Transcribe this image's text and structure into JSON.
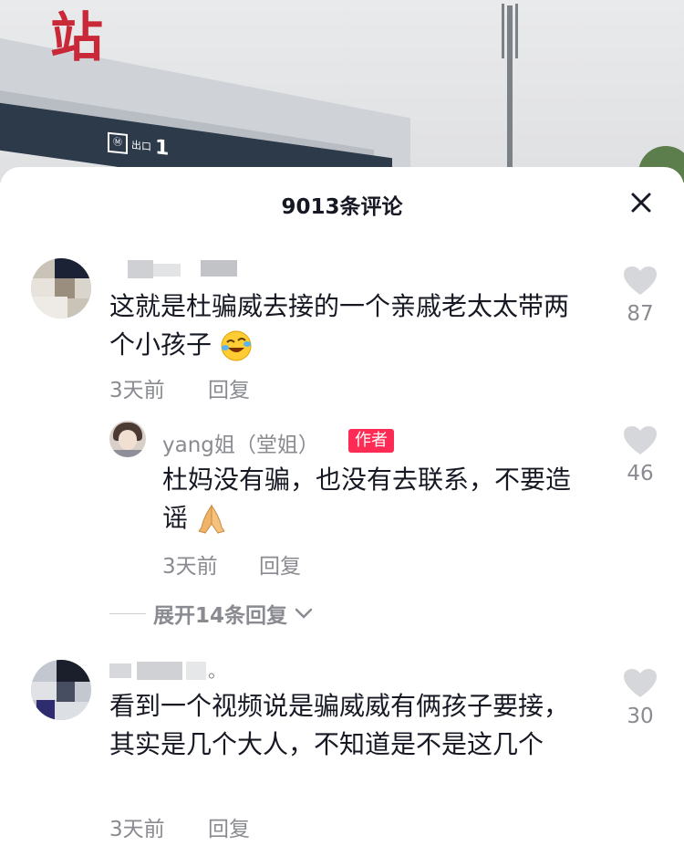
{
  "background": {
    "sign_char": "站",
    "exit_label": "出口",
    "exit_number": "1"
  },
  "header": {
    "title": "9013条评论"
  },
  "comments": [
    {
      "text": "这就是杜骗威去接的一个亲戚老太太带两个小孩子",
      "time": "3天前",
      "reply_label": "回复",
      "likes": "87",
      "emoji": "rolling-laughing"
    },
    {
      "author": "yang姐（堂姐）",
      "badge": "作者",
      "text": "杜妈没有骗，也没有去联系，不要造谣",
      "time": "3天前",
      "reply_label": "回复",
      "likes": "46",
      "emoji": "folded-hands"
    },
    {
      "name_suffix": "。",
      "text": "看到一个视频说是骗威威有俩孩子要接，其实是几个大人，不知道是不是这几个",
      "time": "3天前",
      "reply_label": "回复",
      "likes": "30"
    }
  ],
  "expand_replies": {
    "label": "展开14条回复"
  },
  "colors": {
    "accent": "#fe2c55",
    "text": "#161823",
    "muted": "#8a8b91"
  },
  "icons": [
    "close-icon",
    "heart-icon",
    "chevron-down-icon"
  ]
}
